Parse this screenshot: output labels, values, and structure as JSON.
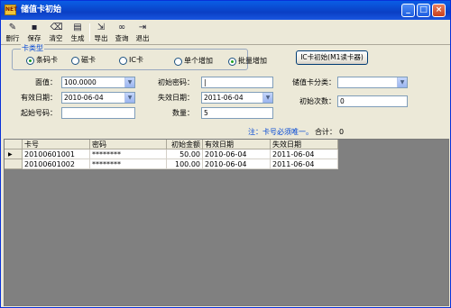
{
  "window": {
    "app_icon_text": "NET",
    "title": "储值卡初始"
  },
  "toolbar": {
    "items": [
      "删行",
      "保存",
      "清空",
      "生成",
      "导出",
      "查询",
      "退出"
    ]
  },
  "card_type": {
    "legend": "卡类型",
    "options": [
      "条码卡",
      "磁卡",
      "IC卡"
    ],
    "selected": "条码卡"
  },
  "add_mode": {
    "options": [
      "单个增加",
      "批量增加"
    ],
    "selected": "批量增加"
  },
  "ic_init_button": "IC卡初始(M1读卡器)",
  "form": {
    "face_value": {
      "label": "面值：",
      "value": "100.0000"
    },
    "init_password": {
      "label": "初始密码：",
      "value": "|"
    },
    "card_category": {
      "label": "储值卡分类：",
      "value": ""
    },
    "effective_date": {
      "label": "有效日期：",
      "value": "2010-06-04"
    },
    "expire_date": {
      "label": "失效日期：",
      "value": "2011-06-04"
    },
    "init_count": {
      "label": "初始次数：",
      "value": "0"
    },
    "start_number": {
      "label": "起始号码：",
      "value": ""
    },
    "quantity": {
      "label": "数量：",
      "value": "5"
    }
  },
  "note": "注：卡号必须唯一。",
  "total": {
    "label": "合计：",
    "value": "0"
  },
  "grid": {
    "columns": [
      "卡号",
      "密码",
      "初始金额",
      "有效日期",
      "失效日期"
    ],
    "rows": [
      [
        "20100601001",
        "********",
        "50.00",
        "2010-06-04",
        "2011-06-04"
      ],
      [
        "20100601002",
        "********",
        "100.00",
        "2010-06-04",
        "2011-06-04"
      ]
    ],
    "current_row_marker": "▶"
  },
  "icons": {
    "minimize": "minimize-icon",
    "maximize": "maximize-icon",
    "close": "close-icon"
  },
  "colors": {
    "title_bar": "#0a3fc4",
    "accent_text": "#0046d5",
    "window_bg": "#ece9d8"
  }
}
